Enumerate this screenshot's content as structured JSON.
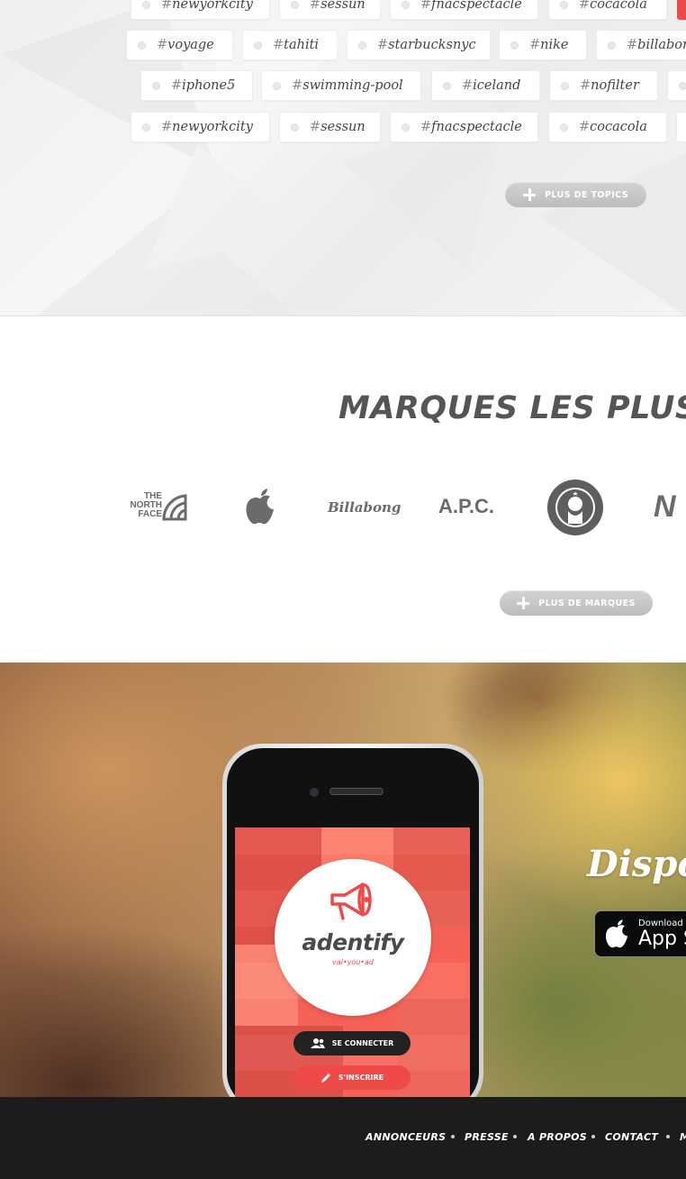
{
  "topics": {
    "rows": [
      [
        {
          "text": "newyorkcity"
        },
        {
          "text": "sessun"
        },
        {
          "text": "fnacspectacle"
        },
        {
          "text": "cocacola"
        },
        {
          "text": "",
          "highlight": true
        }
      ],
      [
        {
          "text": "voyage"
        },
        {
          "text": "tahiti"
        },
        {
          "text": "starbucksnyc"
        },
        {
          "text": "nike"
        },
        {
          "text": "billabong"
        }
      ],
      [
        {
          "text": "iphone5"
        },
        {
          "text": "swimming-pool"
        },
        {
          "text": "iceland"
        },
        {
          "text": "nofilter"
        },
        {
          "text": ""
        }
      ],
      [
        {
          "text": "newyorkcity"
        },
        {
          "text": "sessun"
        },
        {
          "text": "fnacspectacle"
        },
        {
          "text": "cocacola"
        },
        {
          "text": ""
        }
      ]
    ],
    "hash": "#",
    "more_button": "PLUS DE TOPICS"
  },
  "brands": {
    "title": "MARQUES LES PLUS TA",
    "logos": [
      {
        "name": "the-north-face-logo",
        "line1": "THE",
        "line2": "NORTH",
        "line3": "FACE"
      },
      {
        "name": "apple-logo"
      },
      {
        "name": "billabong-logo",
        "text": "Billabong"
      },
      {
        "name": "apc-logo",
        "text": "A.P.C."
      },
      {
        "name": "starbucks-logo"
      },
      {
        "name": "new-balance-logo",
        "text": "N"
      }
    ],
    "more_button": "PLUS DE MARQUES"
  },
  "app_promo": {
    "app_name": "adentify",
    "tagline": "val•you•ad",
    "login_button": "SE CONNECTER",
    "signup_button": "S'INSCRIRE",
    "headline": "Dispo s",
    "store_small": "Download",
    "store_big": "App S",
    "accent_color": "#ef4a4a"
  },
  "footer": {
    "links": [
      "ANNONCEURS",
      "PRESSE",
      "A PROPOS",
      "CONTACT",
      "M"
    ]
  }
}
